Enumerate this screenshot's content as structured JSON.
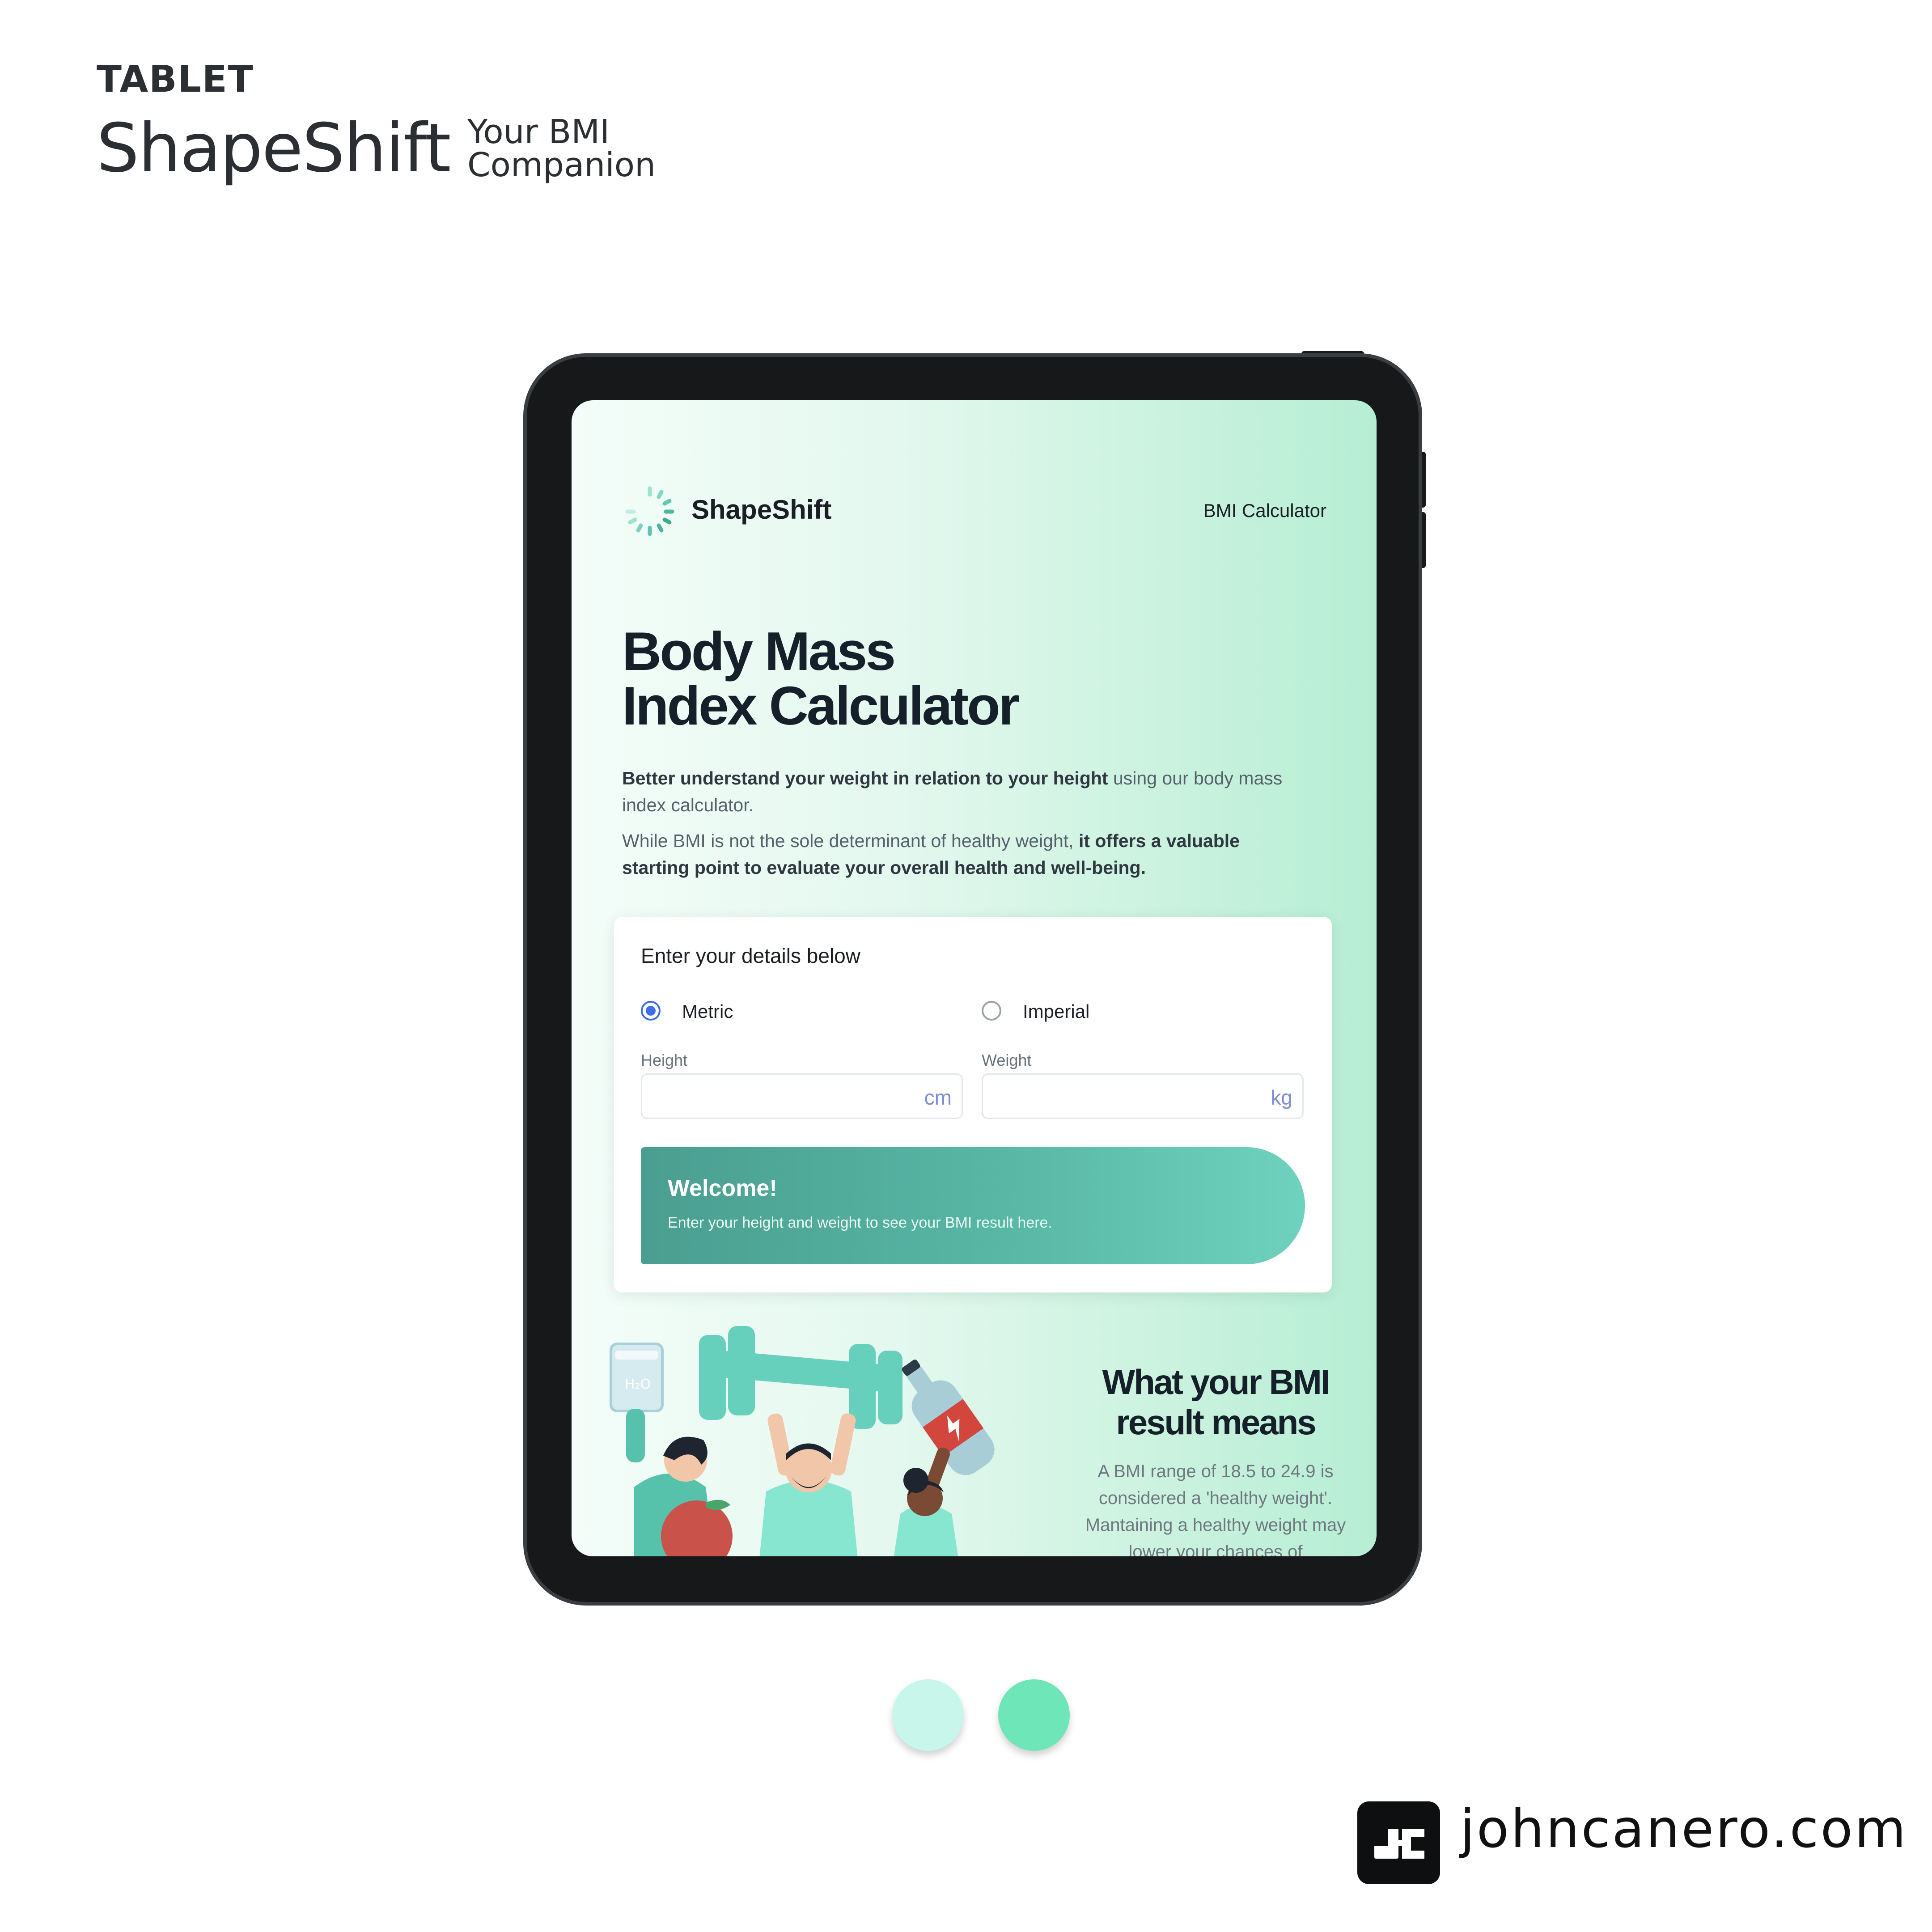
{
  "showcase": {
    "device_label": "TABLET",
    "app_name": "ShapeShift",
    "tagline_line1": "Your BMI",
    "tagline_line2": "Companion",
    "site": "johncanero.com"
  },
  "app": {
    "logo_text": "ShapeShift",
    "nav_link": "BMI Calculator",
    "hero": {
      "title_line1": "Body Mass",
      "title_line2": "Index Calculator",
      "p1_bold": "Better understand your weight in relation to your height",
      "p1_rest": " using our body mass index calculator.",
      "p2_start": "While BMI is not the sole determinant of healthy weight, ",
      "p2_bold": "it offers a valuable starting point to evaluate your overall health and well-being."
    },
    "form": {
      "heading": "Enter your details below",
      "metric_label": "Metric",
      "imperial_label": "Imperial",
      "selected_unit": "Metric",
      "height_label": "Height",
      "height_value": "",
      "height_unit": "cm",
      "weight_label": "Weight",
      "weight_value": "",
      "weight_unit": "kg"
    },
    "result": {
      "title": "Welcome!",
      "text": "Enter your height and weight to see your BMI result here."
    },
    "meaning": {
      "title_line1": "What your BMI",
      "title_line2": "result means",
      "text": "A BMI range of 18.5 to 24.9 is considered a 'healthy weight'. Mantaining a healthy weight may lower your chances of"
    },
    "illustration_glass_text": "H₂O"
  },
  "colors": {
    "swatch_light": "#c9f6ea",
    "swatch_green": "#6ee6b7",
    "accent_blue": "#3b6ee8",
    "teal_start": "#4a9e90",
    "teal_end": "#6ed2be"
  },
  "icons": [
    "spinner-logo-icon",
    "radio-checked-icon",
    "radio-unchecked-icon",
    "jc-logo-icon"
  ]
}
